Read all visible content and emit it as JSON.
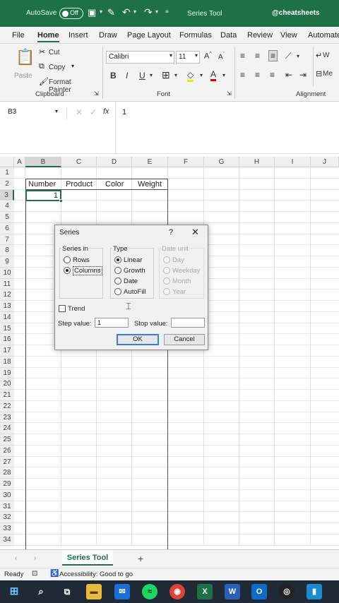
{
  "titlebar": {
    "autosave_label": "AutoSave",
    "toggle_state": "Off",
    "doc_title": "Series Tool",
    "handle": "@cheatsheets"
  },
  "tabs": [
    "File",
    "Home",
    "Insert",
    "Draw",
    "Page Layout",
    "Formulas",
    "Data",
    "Review",
    "View",
    "Automate"
  ],
  "ribbon": {
    "paste": "Paste",
    "cut": "Cut",
    "copy": "Copy",
    "format_painter": "Format Painter",
    "clipboard_group": "Clipboard",
    "font_name": "Calibri",
    "font_size": "11",
    "font_group": "Font",
    "alignment_group": "Alignment",
    "wrap_text": "W",
    "merge": "Me"
  },
  "formula_bar": {
    "name_box": "B3",
    "fx": "fx",
    "value": "1"
  },
  "grid": {
    "columns": [
      "A",
      "B",
      "C",
      "D",
      "E",
      "F",
      "G",
      "H",
      "I",
      "J"
    ],
    "rows": [
      "1",
      "2",
      "3",
      "4",
      "5",
      "6",
      "7",
      "8",
      "9",
      "10",
      "11",
      "12",
      "13",
      "14",
      "15",
      "16",
      "17",
      "18",
      "19",
      "20",
      "21",
      "22",
      "23",
      "24",
      "25",
      "26",
      "27",
      "28",
      "29",
      "30",
      "31",
      "32",
      "33",
      "34"
    ],
    "headers": [
      "Number",
      "Product",
      "Color",
      "Weight"
    ],
    "b3_value": "1"
  },
  "dialog": {
    "title": "Series",
    "help": "?",
    "series_in_label": "Series in",
    "series_in_options": [
      "Rows",
      "Columns"
    ],
    "series_in_selected": "Columns",
    "type_label": "Type",
    "type_options": [
      "Linear",
      "Growth",
      "Date",
      "AutoFill"
    ],
    "type_selected": "Linear",
    "date_unit_label": "Date unit",
    "date_unit_options": [
      "Day",
      "Weekday",
      "Month",
      "Year"
    ],
    "trend_label": "Trend",
    "step_value_label": "Step value:",
    "step_value": "1",
    "stop_value_label": "Stop value:",
    "stop_value": "",
    "ok_label": "OK",
    "cancel_label": "Cancel"
  },
  "sheets": {
    "active": "Series Tool",
    "add": "+"
  },
  "status": {
    "ready": "Ready",
    "accessibility": "Accessibility: Good to go"
  },
  "colors": {
    "excel_green": "#1e7145",
    "taskbar": "#1f2a36",
    "accent_blue": "#3c7bd6"
  }
}
